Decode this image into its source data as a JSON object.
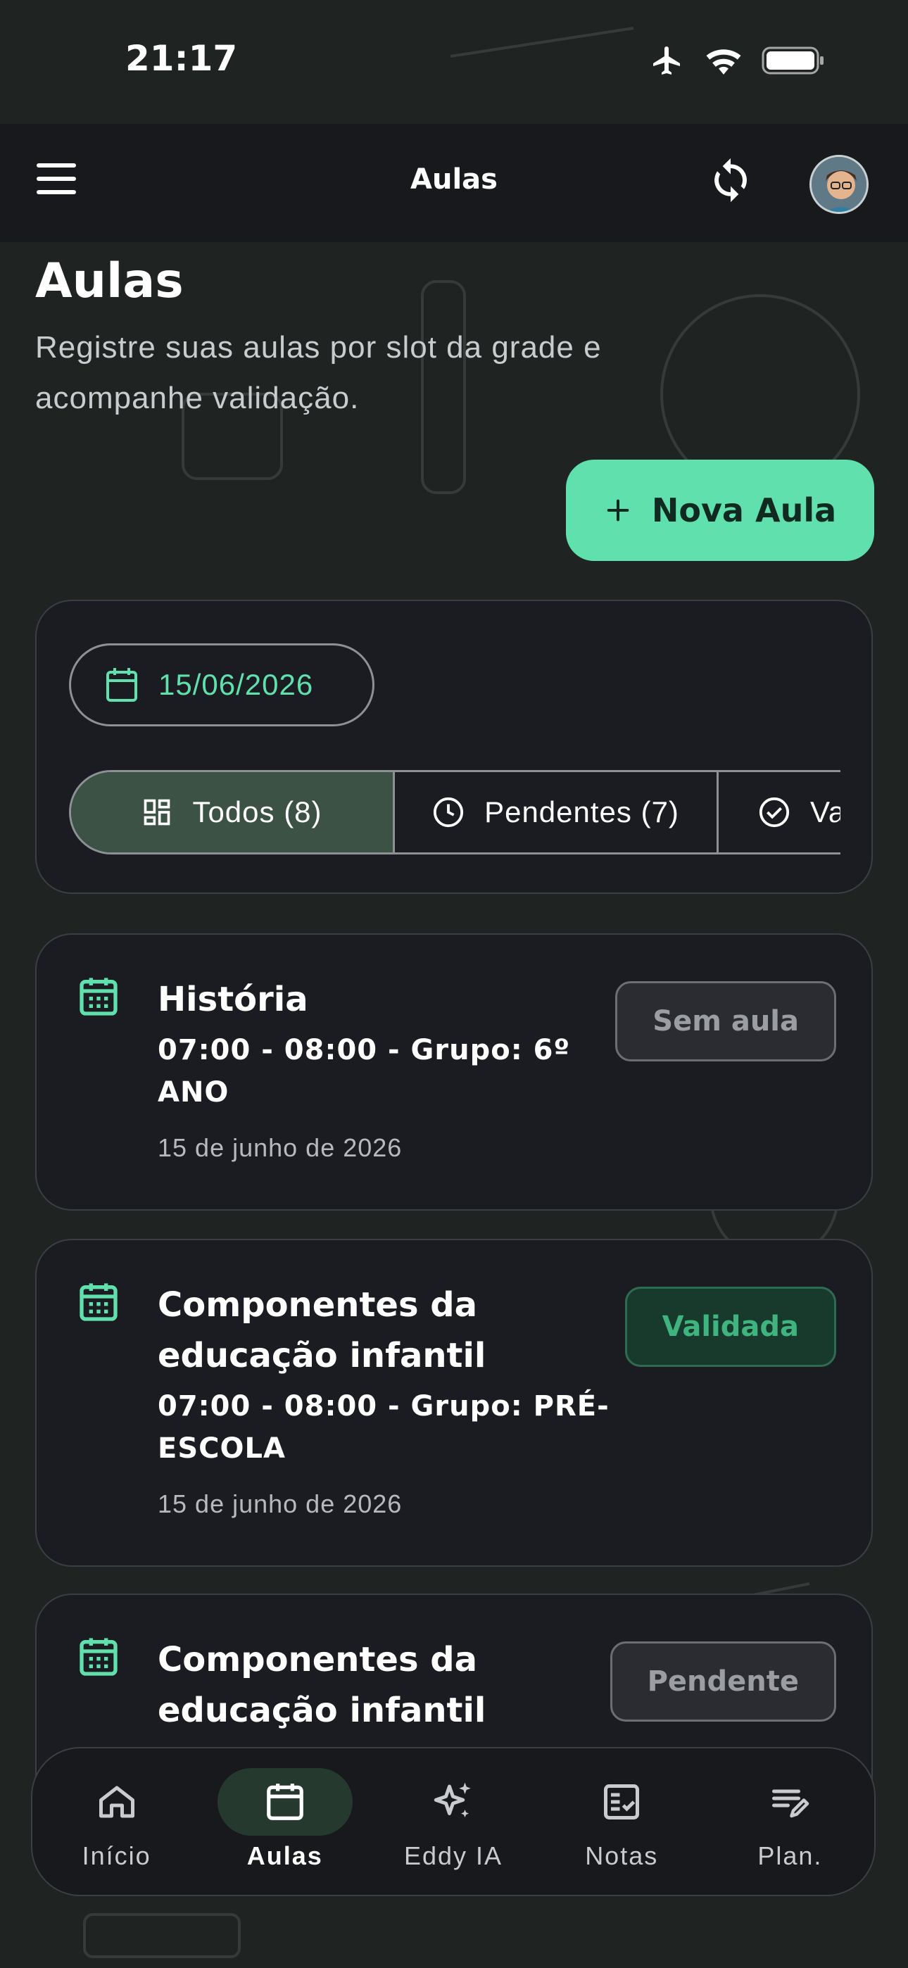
{
  "status_bar": {
    "time": "21:17"
  },
  "app_bar": {
    "title": "Aulas"
  },
  "page": {
    "title": "Aulas",
    "subtitle": "Registre suas aulas por slot da grade e acompanhe validação."
  },
  "new_button": {
    "label": "Nova Aula"
  },
  "filters": {
    "date": "15/06/2026",
    "segments": [
      {
        "label": "Todos (8)",
        "icon": "grid-icon"
      },
      {
        "label": "Pendentes (7)",
        "icon": "clock-icon"
      },
      {
        "label": "Va",
        "icon": "check-circle-icon"
      }
    ]
  },
  "lessons": [
    {
      "subject": "História",
      "time": "07:00 - 08:00 - Grupo: 6º ANO",
      "date": "15 de junho de 2026",
      "status": "Sem aula"
    },
    {
      "subject": "Componentes da educação infantil",
      "time": "07:00 - 08:00 - Grupo: PRÉ-ESCOLA",
      "date": "15 de junho de 2026",
      "status": "Validada"
    },
    {
      "subject": "Componentes da educação infantil",
      "time": "",
      "date": "",
      "status": "Pendente"
    }
  ],
  "nav": [
    {
      "label": "Início",
      "icon": "home-icon"
    },
    {
      "label": "Aulas",
      "icon": "calendar-icon"
    },
    {
      "label": "Eddy IA",
      "icon": "sparkle-icon"
    },
    {
      "label": "Notas",
      "icon": "notes-icon"
    },
    {
      "label": "Plan.",
      "icon": "edit-note-icon"
    }
  ],
  "colors": {
    "accent": "#5fe0ad",
    "background": "#1f2322",
    "card": "#1b1c21"
  }
}
